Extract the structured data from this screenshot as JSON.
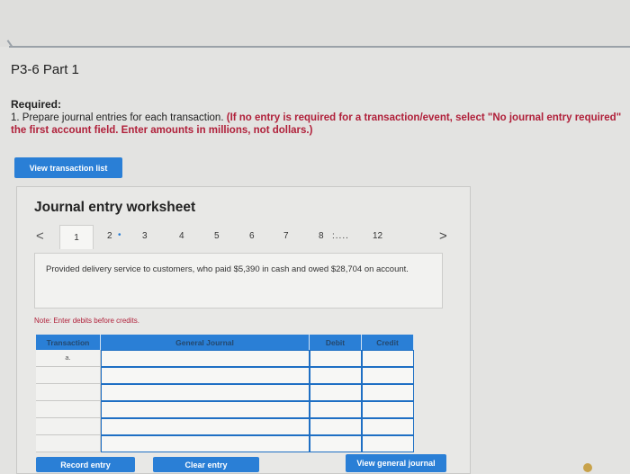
{
  "header": {
    "title": "P3-6 Part 1"
  },
  "required": {
    "heading": "Required:",
    "text_plain": "1. Prepare journal entries for each transaction.",
    "text_red_1": "(If no entry is required for a transaction/event, select \"No journal entry required\"",
    "text_red_2": "the first account field. Enter amounts in millions, not dollars.)"
  },
  "buttons": {
    "view_transaction_list": "View transaction list",
    "record_entry": "Record entry",
    "clear_entry": "Clear entry",
    "view_general_journal": "View general journal"
  },
  "worksheet": {
    "title": "Journal entry worksheet",
    "nav_prev": "<",
    "nav_next": ">",
    "pages": [
      "1",
      "2",
      "3",
      "4",
      "5",
      "6",
      "7",
      "8",
      "12"
    ],
    "dot_after_2": "•",
    "ellipsis": ":....",
    "current_page": "1",
    "description": "Provided delivery service to customers, who paid $5,390 in cash and owed $28,704 on account.",
    "note": "Note: Enter debits before credits.",
    "columns": [
      "Transaction",
      "General Journal",
      "Debit",
      "Credit"
    ],
    "rows": [
      {
        "transaction": "a.",
        "account": "",
        "debit": "",
        "credit": ""
      },
      {
        "transaction": "",
        "account": "",
        "debit": "",
        "credit": ""
      },
      {
        "transaction": "",
        "account": "",
        "debit": "",
        "credit": ""
      },
      {
        "transaction": "",
        "account": "",
        "debit": "",
        "credit": ""
      },
      {
        "transaction": "",
        "account": "",
        "debit": "",
        "credit": ""
      },
      {
        "transaction": "",
        "account": "",
        "debit": "",
        "credit": ""
      }
    ]
  },
  "colors": {
    "accent": "#2a7fd6",
    "required_red": "#b0203a",
    "background": "#e3e3e1"
  }
}
